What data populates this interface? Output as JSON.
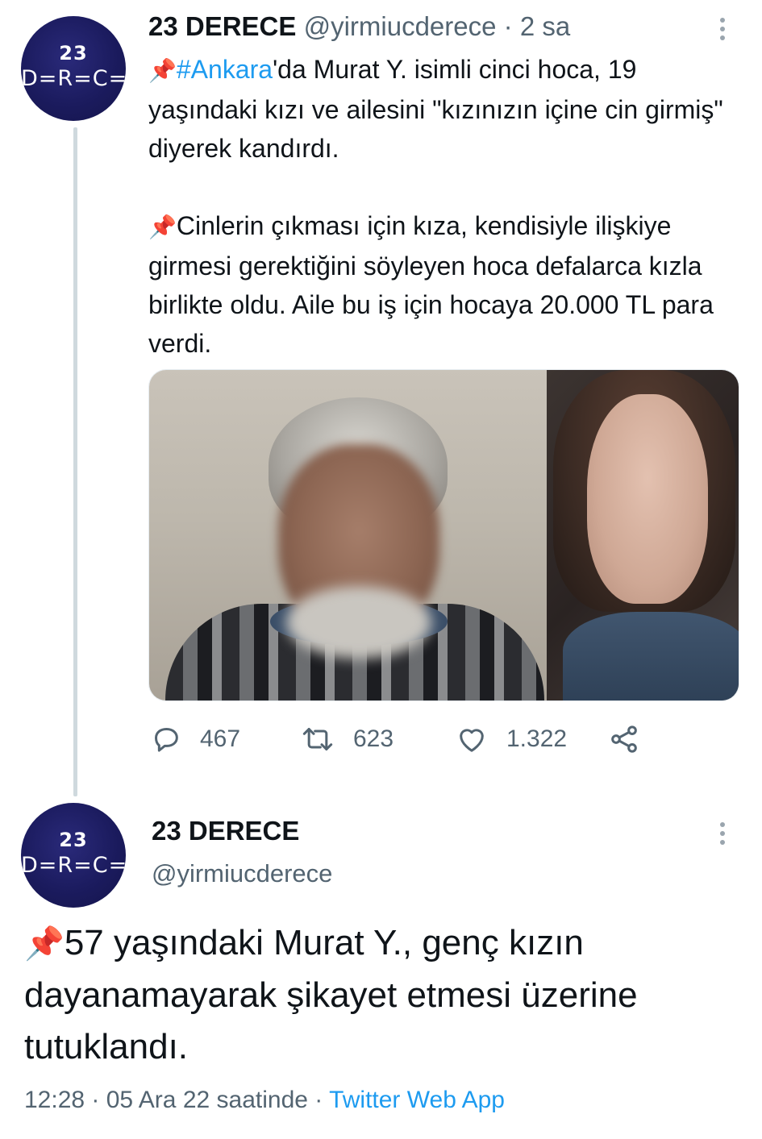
{
  "tweet1": {
    "author": {
      "name": "23 DERECE",
      "handle": "@yirmiucderece",
      "separator": "·",
      "time": "2 sa",
      "avatar_logo_number": "23",
      "avatar_logo_word": "D=R=C="
    },
    "paragraph1": {
      "pin_icon": "📌",
      "hashtag": "#Ankara",
      "text": "'da Murat Y. isimli cinci hoca, 19 yaşındaki kızı ve ailesini \"kızınızın içine cin girmiş\" diyerek kandırdı."
    },
    "paragraph2": {
      "pin_icon": "📌",
      "text": "Cinlerin çıkması için kıza, kendisiyle ilişkiye girmesi gerektiğini söyleyen hoca defalarca kızla birlikte oldu. Aile bu iş için hocaya 20.000 TL para verdi."
    },
    "actions": {
      "replies": "467",
      "retweets": "623",
      "likes": "1.322"
    }
  },
  "tweet2": {
    "author": {
      "name": "23 DERECE",
      "handle": "@yirmiucderece",
      "avatar_logo_number": "23",
      "avatar_logo_word": "D=R=C="
    },
    "pin_icon": "📌",
    "text": "57 yaşındaki Murat Y., genç kızın dayanamayarak şikayet etmesi üzerine tutuklandı.",
    "meta": {
      "time": "12:28",
      "sep1": " · ",
      "date": "05 Ara 22 saatinde",
      "sep2": " · ",
      "source": "Twitter Web App"
    }
  },
  "colors": {
    "link": "#1d9bf0",
    "secondary_text": "#536471",
    "avatar_bg": "#1b1b5e"
  }
}
